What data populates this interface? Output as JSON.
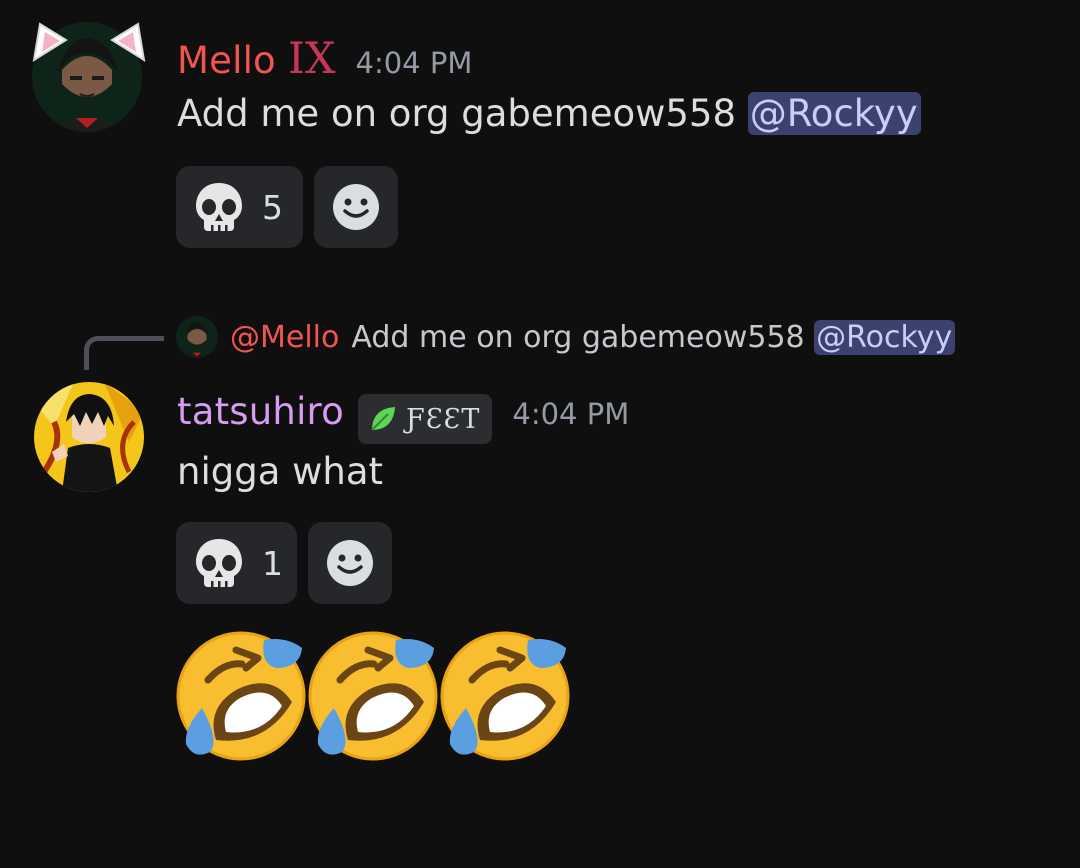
{
  "messages": [
    {
      "username": "Mello",
      "clan_tag": "IX",
      "timestamp": "4:04 PM",
      "text": "Add me on org gabemeow558 ",
      "mention": "@Rockyy",
      "avatar_icon": "cat-ear-character-avatar",
      "reactions": [
        {
          "emoji": "skull-icon",
          "count": "5"
        }
      ]
    },
    {
      "reply": {
        "user": "@Mello",
        "text": "Add me on org gabemeow558 ",
        "mention": "@Rockyy"
      },
      "username": "tatsuhiro",
      "clan_tag": "ƑƐƐT",
      "clan_tag_icon": "leaf-icon",
      "timestamp": "4:04 PM",
      "text": "nigga what",
      "avatar_icon": "anime-character-avatar",
      "reactions": [
        {
          "emoji": "skull-icon",
          "count": "1"
        }
      ],
      "emoji_row": [
        "rolling-on-floor-laughing-icon",
        "rolling-on-floor-laughing-icon",
        "rolling-on-floor-laughing-icon"
      ]
    }
  ],
  "colors": {
    "background": "#0f0f10",
    "mello_name": "#f0554f",
    "tatsuhiro_name": "#d59cf0",
    "mention_bg": "#3c4270",
    "reaction_bg": "#26272b"
  }
}
